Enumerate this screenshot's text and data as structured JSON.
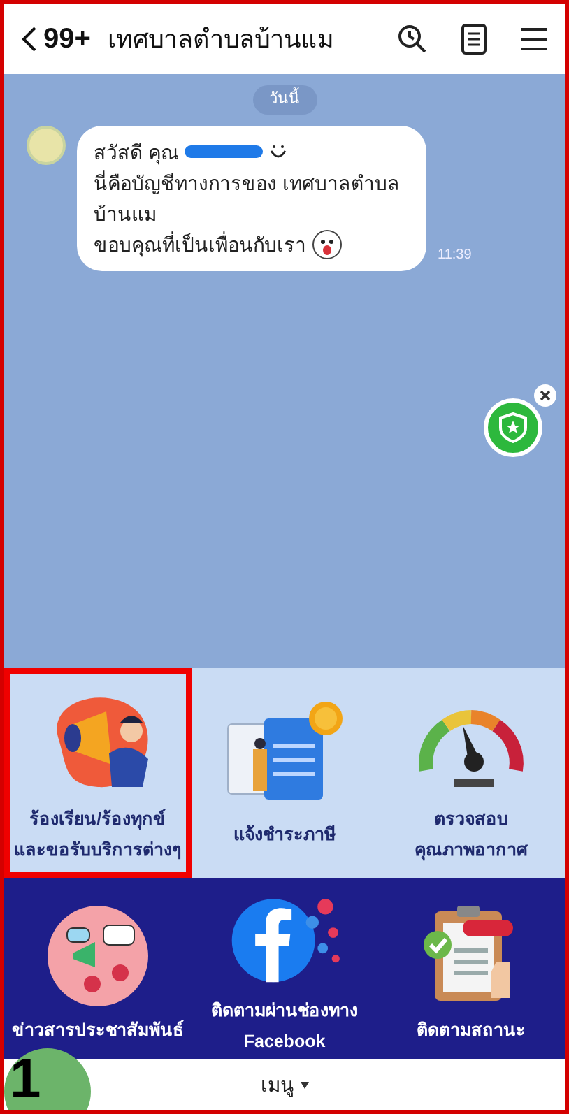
{
  "header": {
    "back_count": "99+",
    "title": "เทศบาลตำบลบ้านแม"
  },
  "chat": {
    "date_chip": "วันนี้",
    "message": {
      "greeting": "สวัสดี คุณ",
      "body": "นี่คือบัญชีทางการของ เทศบาลตำบล บ้านแม",
      "thanks": "ขอบคุณที่เป็นเพื่อนกับเรา",
      "time": "11:39"
    }
  },
  "rich_menu": [
    {
      "kind": "megaphone",
      "lines": [
        "ร้องเรียน/ร้องทุกข์",
        "และขอรับบริการต่างๆ"
      ],
      "highlighted": true
    },
    {
      "kind": "tax",
      "lines": [
        "แจ้งชำระภาษี"
      ],
      "highlighted": false
    },
    {
      "kind": "gauge",
      "lines": [
        "ตรวจสอบ",
        "คุณภาพอากาศ"
      ],
      "highlighted": false
    },
    {
      "kind": "news",
      "lines": [
        "ข่าวสารประชาสัมพันธ์"
      ],
      "highlighted": false
    },
    {
      "kind": "facebook",
      "lines": [
        "ติดตามผ่านช่องทาง",
        "Facebook"
      ],
      "highlighted": false
    },
    {
      "kind": "clipboard",
      "lines": [
        "ติดตามสถานะ"
      ],
      "highlighted": false
    }
  ],
  "menu_bar": {
    "label": "เมนู"
  },
  "step_badge": "1"
}
